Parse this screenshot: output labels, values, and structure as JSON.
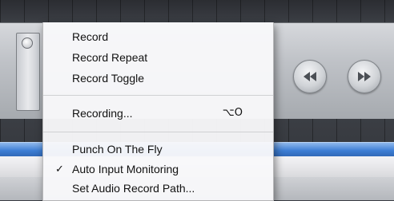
{
  "transport": {
    "buttons": [
      {
        "name": "rewind-button",
        "icon": "rewind-icon"
      },
      {
        "name": "fast-forward-button",
        "icon": "fast-forward-icon"
      }
    ]
  },
  "menu": {
    "items": [
      {
        "label": "Record",
        "checked": false,
        "shortcut": ""
      },
      {
        "label": "Record Repeat",
        "checked": false,
        "shortcut": ""
      },
      {
        "label": "Record Toggle",
        "checked": false,
        "shortcut": ""
      },
      {
        "label": "Recording...",
        "checked": false,
        "shortcut": "⌥O"
      },
      {
        "label": "Punch On The Fly",
        "checked": false,
        "shortcut": ""
      },
      {
        "label": "Auto Input Monitoring",
        "checked": true,
        "check_mark": "✓",
        "shortcut": ""
      },
      {
        "label": "Set Audio Record Path...",
        "checked": false,
        "shortcut": ""
      }
    ]
  },
  "colors": {
    "menu_bg": "#f8f8fa",
    "transport_light": "#d6d8dc",
    "region_blue": "#3d7ed4"
  }
}
